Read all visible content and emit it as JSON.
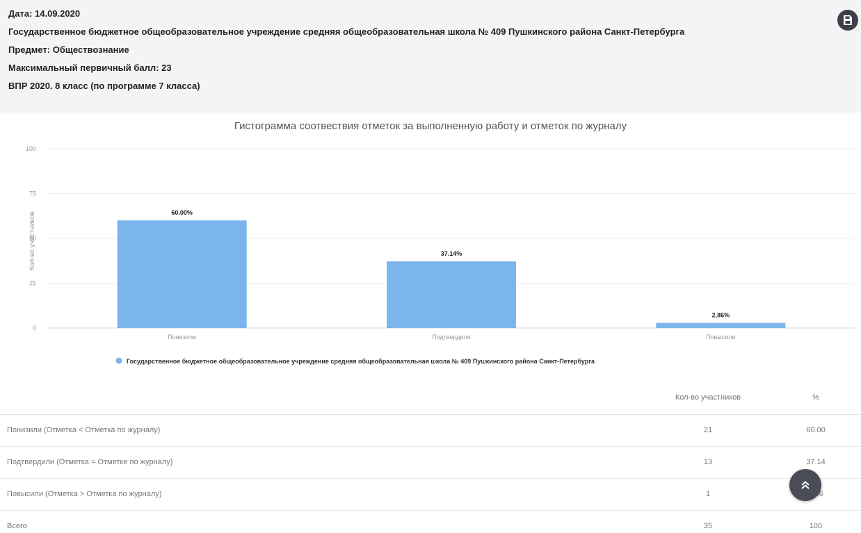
{
  "info": {
    "date": "Дата: 14.09.2020",
    "school": "Государственное бюджетное общеобразовательное учреждение средняя общеобразовательная школа № 409 Пушкинского района Санкт-Петербурга",
    "subject": "Предмет: Обществознание",
    "max_score": "Максимальный первичный балл: 23",
    "exam": "ВПР 2020. 8 класс (по программе 7 класса)"
  },
  "icons": {
    "save": "save-icon",
    "scroll_top": "double-chevron-up-icon"
  },
  "chart_data": {
    "type": "bar",
    "title": "Гистограмма соотвествия отметок за выполненную работу и отметок по журналу",
    "ylabel": "Кол-во участников",
    "xlabel": "",
    "categories": [
      "Понизили",
      "Подтвердили",
      "Повысили"
    ],
    "series": [
      {
        "name": "Государственное бюджетное общеобразовательное учреждение средняя общеобразовательная школа № 409 Пушкинского района Санкт-Петербурга",
        "values": [
          60.0,
          37.14,
          2.86
        ],
        "labels": [
          "60.00%",
          "37.14%",
          "2.86%"
        ]
      }
    ],
    "ylim": [
      0,
      100
    ],
    "yticks": [
      "0",
      "25",
      "50",
      "75",
      "100"
    ],
    "grid": true,
    "legend_position": "bottom",
    "color": "#7cb5ec"
  },
  "table": {
    "headers": [
      "",
      "Кол-во участников",
      "%"
    ],
    "rows": [
      [
        "Понизили (Отметка < Отметка по журналу)",
        "21",
        "60.00"
      ],
      [
        "Подтвердили (Отметка = Отметке по журналу)",
        "13",
        "37.14"
      ],
      [
        "Повысили (Отметка > Отметка по журналу)",
        "1",
        "2.86"
      ],
      [
        "Всего",
        "35",
        "100"
      ]
    ]
  }
}
